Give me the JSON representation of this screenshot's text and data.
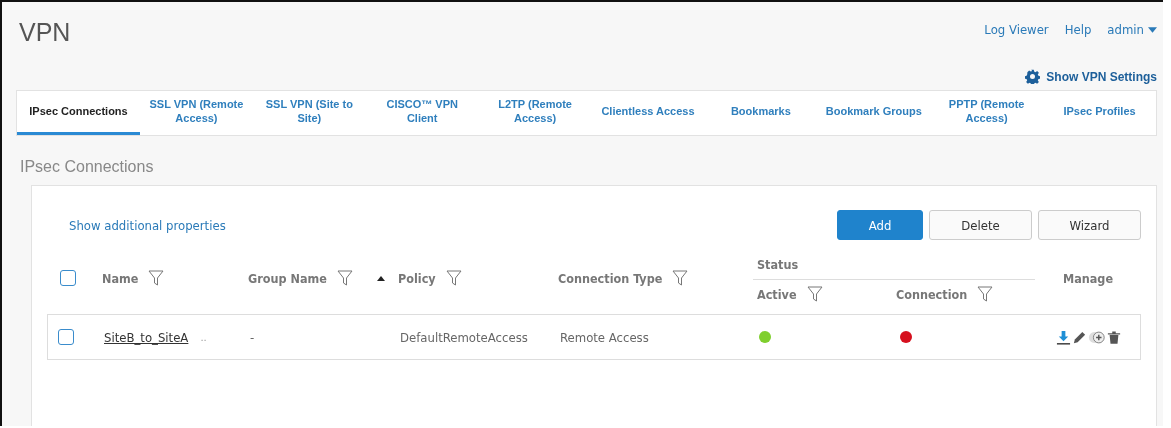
{
  "page_title": "VPN",
  "top_links": [
    {
      "label": "Log Viewer",
      "dropdown": false
    },
    {
      "label": "Help",
      "dropdown": false
    },
    {
      "label": "admin",
      "dropdown": true
    }
  ],
  "settings_link": "Show VPN Settings",
  "tabs": [
    {
      "label": "IPsec Connections",
      "selected": true
    },
    {
      "label": "SSL VPN (Remote Access)",
      "selected": false
    },
    {
      "label": "SSL VPN (Site to Site)",
      "selected": false
    },
    {
      "label": "CISCO™ VPN Client",
      "selected": false
    },
    {
      "label": "L2TP (Remote Access)",
      "selected": false
    },
    {
      "label": "Clientless Access",
      "selected": false
    },
    {
      "label": "Bookmarks",
      "selected": false
    },
    {
      "label": "Bookmark Groups",
      "selected": false
    },
    {
      "label": "PPTP (Remote Access)",
      "selected": false
    },
    {
      "label": "IPsec Profiles",
      "selected": false
    }
  ],
  "section_title": "IPsec Connections",
  "properties_link": "Show additional properties",
  "buttons": [
    {
      "label": "Add",
      "primary": true
    },
    {
      "label": "Delete",
      "primary": false
    },
    {
      "label": "Wizard",
      "primary": false
    }
  ],
  "table": {
    "select_all_checked": false,
    "columns": {
      "name": "Name",
      "group": "Group Name",
      "policy": "Policy",
      "type": "Connection Type",
      "status": "Status",
      "active": "Active",
      "connection": "Connection",
      "manage": "Manage"
    },
    "rows": [
      {
        "checked": false,
        "name": "SiteB_to_SiteA",
        "more": "..",
        "group": "-",
        "policy": "DefaultRemoteAccess",
        "type": "Remote Access",
        "active": true,
        "connected": false
      }
    ]
  }
}
